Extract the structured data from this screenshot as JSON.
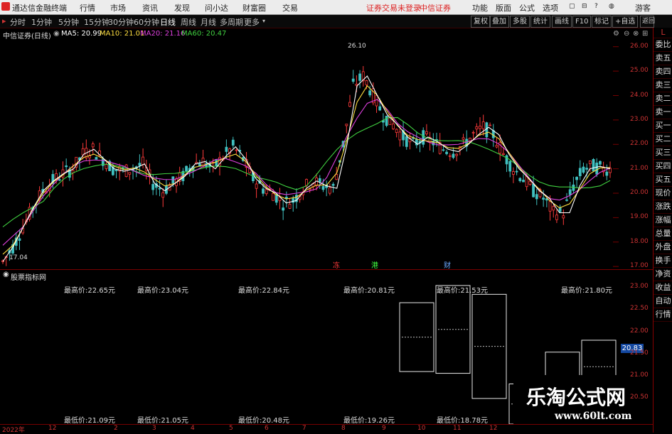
{
  "app": {
    "title": "通达信金融终端",
    "login_status": "证券交易未登录",
    "broker": "中信证券",
    "user": "游客"
  },
  "menu": {
    "left": [
      "行情",
      "市场",
      "资讯",
      "发现",
      "问小达",
      "财富圈",
      "交易"
    ],
    "right": [
      "功能",
      "版面",
      "公式",
      "选项"
    ]
  },
  "toolbar": {
    "periods": [
      "分时",
      "1分钟",
      "5分钟",
      "15分钟",
      "30分钟",
      "60分钟",
      "日线",
      "周线",
      "月线",
      "多周期",
      "更多"
    ],
    "active": "日线",
    "right_buttons": [
      "复权",
      "叠加",
      "多股",
      "统计",
      "画线",
      "F10",
      "标记",
      "+自选",
      "返回"
    ]
  },
  "chart_header": {
    "name": "中信证券(日线)",
    "ma5": "MA5: 20.99",
    "ma10": "MA10: 21.01",
    "ma20": "MA20: 21.16",
    "ma60": "MA60: 20.47"
  },
  "colors": {
    "ma5": "#ffffff",
    "ma10": "#ffdf40",
    "ma20": "#e040e0",
    "ma60": "#40d040",
    "up": "#ff3a3a",
    "down": "#40c0c0"
  },
  "sidebar": [
    "L",
    "委比",
    "卖五",
    "卖四",
    "卖三",
    "卖二",
    "卖一",
    "买一",
    "买二",
    "买三",
    "买四",
    "买五",
    "现价",
    "涨跌",
    "涨幅",
    "总量",
    "外盘",
    "换手",
    "净资",
    "收益",
    "自动",
    "行情"
  ],
  "main_yaxis": [
    "26.00",
    "25.00",
    "24.00",
    "23.00",
    "22.00",
    "21.00",
    "20.00",
    "19.00",
    "18.00",
    "17.00"
  ],
  "annotations": {
    "high": "26.10",
    "low": "17.04"
  },
  "event_markers": [
    {
      "label": "冻",
      "color": "#ff3a3a"
    },
    {
      "label": "港",
      "color": "#40ff40"
    },
    {
      "label": "财",
      "color": "#6aa8ff"
    }
  ],
  "sub_chart": {
    "title": "股票指标网",
    "yaxis": [
      "23.00",
      "22.50",
      "22.00",
      "21.50",
      "21.00",
      "20.50"
    ],
    "current_price": "20.83",
    "highs": [
      "最高价:22.65元",
      "最高价:23.04元",
      "最高价:22.84元",
      "最高价:20.81元",
      "最高价:21.53元",
      "最高价:21.80元"
    ],
    "lows": [
      "最低价:21.09元",
      "最低价:21.05元",
      "最低价:20.48元",
      "最低价:19.26元",
      "最低价:18.78元"
    ]
  },
  "xaxis": [
    "2022年",
    "12",
    "2",
    "3",
    "4",
    "5",
    "6",
    "7",
    "8",
    "9",
    "10",
    "11",
    "12"
  ],
  "chart_data": [
    {
      "type": "candlestick",
      "title": "中信证券(日线)",
      "ylim": [
        16.8,
        26.4
      ],
      "series": [
        {
          "name": "MA5",
          "values": [
            17.2,
            17.8,
            18.6,
            19.4,
            20.1,
            20.5,
            20.8,
            21.0,
            21.6,
            21.8,
            21.4,
            21.0,
            20.9,
            21.0,
            21.2,
            20.4,
            20.1,
            20.4,
            20.7,
            21.2,
            21.3,
            21.0,
            21.5,
            21.9,
            21.4,
            20.6,
            20.2,
            20.0,
            19.6,
            19.7,
            20.2,
            20.5,
            20.3,
            20.2,
            22.0,
            24.4,
            24.8,
            24.0,
            23.2,
            22.8,
            22.3,
            22.0,
            22.3,
            22.1,
            21.8,
            21.7,
            22.0,
            22.4,
            22.7,
            22.4,
            21.6,
            21.0,
            20.6,
            20.1,
            19.8,
            19.2,
            19.2,
            20.3,
            21.0,
            21.1,
            21.0
          ]
        }
      ]
    },
    {
      "type": "bar",
      "title": "股票指标网",
      "categories": [
        "1",
        "2",
        "3",
        "4",
        "5",
        "6"
      ],
      "series": [
        {
          "name": "最高价",
          "values": [
            22.65,
            23.04,
            22.84,
            20.81,
            21.53,
            21.8
          ]
        },
        {
          "name": "最低价",
          "values": [
            21.09,
            21.05,
            20.48,
            19.26,
            18.78
          ]
        }
      ]
    }
  ]
}
